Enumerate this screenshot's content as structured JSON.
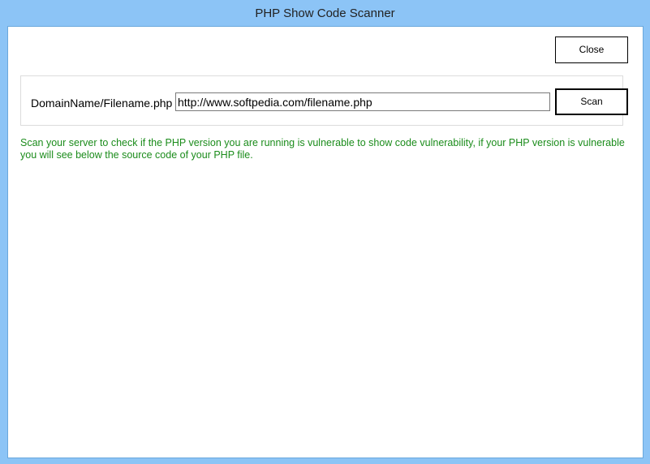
{
  "window": {
    "title": "PHP Show Code Scanner"
  },
  "toolbar": {
    "close_label": "Close"
  },
  "form": {
    "label": "DomainName/Filename.php",
    "url_value": "http://www.softpedia.com/filename.php",
    "scan_label": "Scan"
  },
  "help_text": "Scan your server to check if the PHP version you are running is vulnerable to show code vulnerability, if your PHP version is vulnerable you will see below the source code of your PHP file.",
  "colors": {
    "frame": "#8cc4f6",
    "help_text": "#1b8c1b"
  }
}
